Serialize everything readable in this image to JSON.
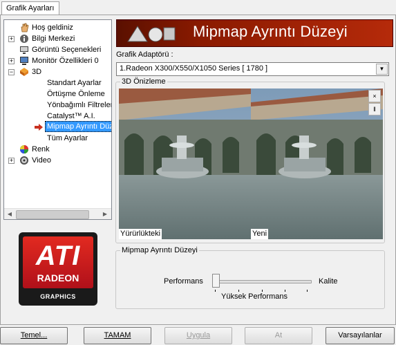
{
  "tabs": {
    "active_label": "Grafik Ayarları"
  },
  "tree": {
    "items": [
      {
        "label": "Hoş geldiniz",
        "icon": "hand-icon",
        "expander": ""
      },
      {
        "label": "Bilgi Merkezi",
        "icon": "info-icon",
        "expander": "+"
      },
      {
        "label": "Görüntü Seçenekleri",
        "icon": "display-icon",
        "expander": ""
      },
      {
        "label": "Monitör Özellikleri 0",
        "icon": "monitor-icon",
        "expander": "+"
      },
      {
        "label": "3D",
        "icon": "3d-icon",
        "expander": "−"
      },
      {
        "label": "Standart Ayarlar",
        "icon": "",
        "expander": ""
      },
      {
        "label": "Örtüşme Önleme",
        "icon": "",
        "expander": ""
      },
      {
        "label": "Yönbağımlı Filtreleme",
        "icon": "",
        "expander": ""
      },
      {
        "label": "Catalyst™ A.I.",
        "icon": "",
        "expander": ""
      },
      {
        "label": "Mipmap Ayrıntı Düzeyi",
        "icon": "arrow-right-icon",
        "expander": ""
      },
      {
        "label": "Tüm Ayarlar",
        "icon": "",
        "expander": ""
      },
      {
        "label": "Renk",
        "icon": "color-wheel-icon",
        "expander": ""
      },
      {
        "label": "Video",
        "icon": "video-icon",
        "expander": "+"
      }
    ],
    "selected_index": 9
  },
  "logo": {
    "brand": "ATI",
    "product": "RADEON",
    "sub": "GRAPHICS"
  },
  "banner": {
    "title": "Mipmap Ayrıntı Düzeyi"
  },
  "adapter": {
    "label": "Grafik Adaptörü :",
    "value": "1.Radeon X300/X550/X1050 Series [ 1780 ]"
  },
  "preview": {
    "group_title": "3D Önizleme",
    "left_caption": "Yürürlükteki",
    "right_caption": "Yeni",
    "close_glyph": "×",
    "pause_glyph": "‖"
  },
  "mipmap": {
    "group_title": "Mipmap Ayrıntı Düzeyi",
    "left_label": "Performans",
    "right_label": "Kalite",
    "value_label": "Yüksek Performans",
    "slider_value": 0
  },
  "buttons": {
    "basic": "Temel...",
    "ok": "TAMAM",
    "apply": "Uygula",
    "cancel": "At",
    "defaults": "Varsayılanlar"
  },
  "colors": {
    "banner_accent": "#b52a0a",
    "selection": "#3399ff"
  }
}
